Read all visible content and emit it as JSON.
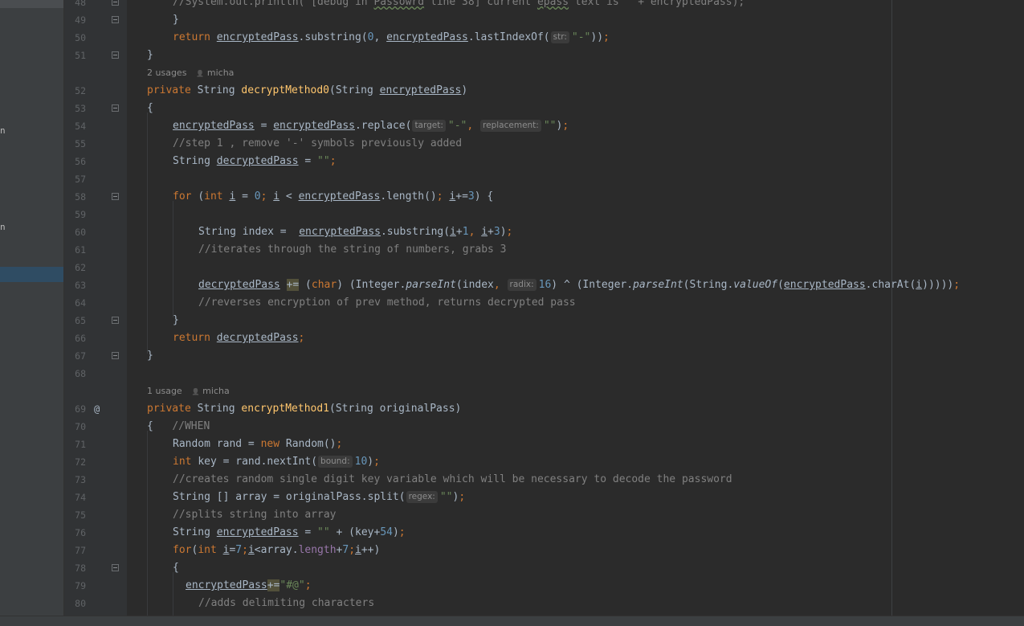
{
  "left_panel": {
    "fragments": [
      "n",
      "n"
    ]
  },
  "gutter": {
    "line_numbers": [
      "48",
      "49",
      "50",
      "51",
      "52",
      "53",
      "54",
      "55",
      "56",
      "57",
      "58",
      "59",
      "60",
      "61",
      "62",
      "63",
      "64",
      "65",
      "66",
      "67",
      "68",
      "69",
      "70",
      "71",
      "72",
      "73",
      "74",
      "75",
      "76",
      "77",
      "78",
      "79",
      "80"
    ],
    "annotation_glyph": "@"
  },
  "hints": {
    "decrypt_usages": "2 usages",
    "decrypt_author": "micha",
    "encrypt_usages": "1 usage",
    "encrypt_author": "micha",
    "author_icon": "person-icon"
  },
  "code": {
    "l48": [
      {
        "t": "//System.out.println(\"[debug in ",
        "c": "cmt"
      },
      {
        "t": "Passowrd",
        "c": "cmt wavy"
      },
      {
        "t": " line 38] current ",
        "c": "cmt"
      },
      {
        "t": "epass",
        "c": "cmt wavy"
      },
      {
        "t": " text is \" + encryptedPass);",
        "c": "cmt"
      }
    ],
    "l49": [
      {
        "t": "}"
      }
    ],
    "l50": [
      {
        "t": "return ",
        "c": "kw"
      },
      {
        "t": "encryptedPass",
        "c": "ul"
      },
      {
        "t": ".substring("
      },
      {
        "t": "0",
        "c": "num"
      },
      {
        "t": ", "
      },
      {
        "t": "encryptedPass",
        "c": "ul"
      },
      {
        "t": ".lastIndexOf("
      },
      {
        "t": "str:",
        "c": "inlay"
      },
      {
        "t": "\"-\"",
        "c": "str"
      },
      {
        "t": "))"
      },
      {
        "t": ";",
        "c": "kw"
      }
    ],
    "l51": [
      {
        "t": "}"
      }
    ],
    "l52": [
      {
        "t": "private ",
        "c": "kw"
      },
      {
        "t": "String "
      },
      {
        "t": "decryptMethod0",
        "c": "fn"
      },
      {
        "t": "(String "
      },
      {
        "t": "encryptedPass",
        "c": "ul"
      },
      {
        "t": ")"
      }
    ],
    "l53": [
      {
        "t": "{"
      }
    ],
    "l54": [
      {
        "t": "encryptedPass",
        "c": "ul"
      },
      {
        "t": " = "
      },
      {
        "t": "encryptedPass",
        "c": "ul"
      },
      {
        "t": ".replace("
      },
      {
        "t": "target:",
        "c": "inlay"
      },
      {
        "t": "\"-\"",
        "c": "str"
      },
      {
        "t": ", ",
        "c": "kw"
      },
      {
        "t": "replacement:",
        "c": "inlay"
      },
      {
        "t": "\"\"",
        "c": "str"
      },
      {
        "t": ")"
      },
      {
        "t": ";",
        "c": "kw"
      }
    ],
    "l55": [
      {
        "t": "//step 1 , remove '-' symbols previously added",
        "c": "cmt"
      }
    ],
    "l56": [
      {
        "t": "String "
      },
      {
        "t": "decryptedPass",
        "c": "ul"
      },
      {
        "t": " = "
      },
      {
        "t": "\"\"",
        "c": "str"
      },
      {
        "t": ";",
        "c": "kw"
      }
    ],
    "l57": [],
    "l58": [
      {
        "t": "for ",
        "c": "kw"
      },
      {
        "t": "("
      },
      {
        "t": "int ",
        "c": "kw"
      },
      {
        "t": "i",
        "c": "ul"
      },
      {
        "t": " = "
      },
      {
        "t": "0",
        "c": "num"
      },
      {
        "t": "; ",
        "c": "kw"
      },
      {
        "t": "i",
        "c": "ul"
      },
      {
        "t": " < "
      },
      {
        "t": "encryptedPass",
        "c": "ul"
      },
      {
        "t": ".length()"
      },
      {
        "t": "; ",
        "c": "kw"
      },
      {
        "t": "i",
        "c": "ul"
      },
      {
        "t": "+="
      },
      {
        "t": "3",
        "c": "num"
      },
      {
        "t": ") {"
      }
    ],
    "l59": [],
    "l60": [
      {
        "t": "String index =  "
      },
      {
        "t": "encryptedPass",
        "c": "ul"
      },
      {
        "t": ".substring("
      },
      {
        "t": "i",
        "c": "ul"
      },
      {
        "t": "+"
      },
      {
        "t": "1",
        "c": "num"
      },
      {
        "t": ", ",
        "c": "kw"
      },
      {
        "t": "i",
        "c": "ul"
      },
      {
        "t": "+"
      },
      {
        "t": "3",
        "c": "num"
      },
      {
        "t": ")"
      },
      {
        "t": ";",
        "c": "kw"
      }
    ],
    "l61": [
      {
        "t": "//iterates through the string of numbers, grabs 3",
        "c": "cmt"
      }
    ],
    "l62": [],
    "l63": [
      {
        "t": "decryptedPass",
        "c": "ul"
      },
      {
        "t": " "
      },
      {
        "t": "+=",
        "c": "hl"
      },
      {
        "t": " ("
      },
      {
        "t": "char",
        "c": "kw"
      },
      {
        "t": ") (Integer."
      },
      {
        "t": "parseInt",
        "c": "ital"
      },
      {
        "t": "(index"
      },
      {
        "t": ", ",
        "c": "kw"
      },
      {
        "t": "radix:",
        "c": "inlay"
      },
      {
        "t": "16",
        "c": "num"
      },
      {
        "t": ") ^ (Integer."
      },
      {
        "t": "parseInt",
        "c": "ital"
      },
      {
        "t": "(String."
      },
      {
        "t": "valueOf",
        "c": "ital"
      },
      {
        "t": "("
      },
      {
        "t": "encryptedPass",
        "c": "ul"
      },
      {
        "t": ".charAt("
      },
      {
        "t": "i",
        "c": "ul"
      },
      {
        "t": ")))))"
      },
      {
        "t": ";",
        "c": "kw"
      }
    ],
    "l64": [
      {
        "t": "//reverses encryption of prev method, returns decrypted pass",
        "c": "cmt"
      }
    ],
    "l65": [
      {
        "t": "}"
      }
    ],
    "l66": [
      {
        "t": "return ",
        "c": "kw"
      },
      {
        "t": "decryptedPass",
        "c": "ul"
      },
      {
        "t": ";",
        "c": "kw"
      }
    ],
    "l67": [
      {
        "t": "}"
      }
    ],
    "l68": [],
    "l69": [
      {
        "t": "private ",
        "c": "kw"
      },
      {
        "t": "String "
      },
      {
        "t": "encryptMethod1",
        "c": "fn"
      },
      {
        "t": "(String originalPass)"
      }
    ],
    "l70": [
      {
        "t": "{   "
      },
      {
        "t": "//WHEN",
        "c": "cmt"
      }
    ],
    "l71": [
      {
        "t": "Random rand = "
      },
      {
        "t": "new ",
        "c": "kw"
      },
      {
        "t": "Random()"
      },
      {
        "t": ";",
        "c": "kw"
      }
    ],
    "l72": [
      {
        "t": "int ",
        "c": "kw"
      },
      {
        "t": "key = rand.nextInt("
      },
      {
        "t": "bound:",
        "c": "inlay"
      },
      {
        "t": "10",
        "c": "num"
      },
      {
        "t": ")"
      },
      {
        "t": ";",
        "c": "kw"
      }
    ],
    "l73": [
      {
        "t": "//creates random single digit key variable which will be necessary to decode the password",
        "c": "cmt"
      }
    ],
    "l74": [
      {
        "t": "String [] array = originalPass.split("
      },
      {
        "t": "regex:",
        "c": "inlay"
      },
      {
        "t": "\"\"",
        "c": "str"
      },
      {
        "t": ")"
      },
      {
        "t": ";",
        "c": "kw"
      }
    ],
    "l75": [
      {
        "t": "//splits string into array",
        "c": "cmt"
      }
    ],
    "l76": [
      {
        "t": "String "
      },
      {
        "t": "encryptedPass",
        "c": "ul"
      },
      {
        "t": " = "
      },
      {
        "t": "\"\"",
        "c": "str"
      },
      {
        "t": " + (key+"
      },
      {
        "t": "54",
        "c": "num"
      },
      {
        "t": ")"
      },
      {
        "t": ";",
        "c": "kw"
      }
    ],
    "l77": [
      {
        "t": "for",
        "c": "kw"
      },
      {
        "t": "("
      },
      {
        "t": "int ",
        "c": "kw"
      },
      {
        "t": "i",
        "c": "ul"
      },
      {
        "t": "="
      },
      {
        "t": "7",
        "c": "num"
      },
      {
        "t": ";",
        "c": "kw"
      },
      {
        "t": "i",
        "c": "ul"
      },
      {
        "t": "<array."
      },
      {
        "t": "length",
        "c": "fld"
      },
      {
        "t": "+"
      },
      {
        "t": "7",
        "c": "num"
      },
      {
        "t": ";",
        "c": "kw"
      },
      {
        "t": "i",
        "c": "ul"
      },
      {
        "t": "++)"
      }
    ],
    "l78": [
      {
        "t": "{"
      }
    ],
    "l79": [
      {
        "t": "encryptedPass",
        "c": "ul"
      },
      {
        "t": "+=",
        "c": "hl"
      },
      {
        "t": "\"#@\"",
        "c": "str"
      },
      {
        "t": ";",
        "c": "kw"
      }
    ],
    "l80": [
      {
        "t": "//adds delimiting characters",
        "c": "cmt"
      }
    ]
  }
}
